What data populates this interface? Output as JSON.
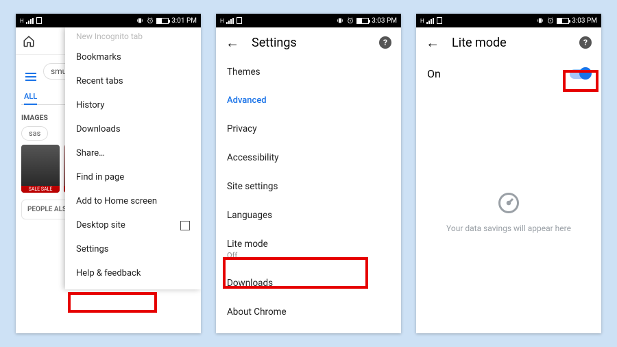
{
  "statusbar": {
    "network_label": "H",
    "time1": "3:01 PM",
    "time2": "3:03 PM",
    "time3": "3:03 PM"
  },
  "screen1": {
    "menu_faded_header": "New Incognito tab",
    "menu_items": [
      "Bookmarks",
      "Recent tabs",
      "History",
      "Downloads",
      "Share…",
      "Find in page",
      "Add to Home screen",
      "Desktop site",
      "Settings",
      "Help & feedback"
    ],
    "search_chip_text": "smu",
    "tab_all": "ALL",
    "section_images": "IMAGES",
    "chip_sas": "sas",
    "thumb_tag": "SALE SALE",
    "section_people": "PEOPLE ALSO ASK"
  },
  "screen2": {
    "title": "Settings",
    "items": {
      "themes": "Themes",
      "advanced": "Advanced",
      "privacy": "Privacy",
      "accessibility": "Accessibility",
      "site_settings": "Site settings",
      "languages": "Languages",
      "lite_mode": "Lite mode",
      "lite_mode_sub": "Off",
      "downloads": "Downloads",
      "about_chrome": "About Chrome"
    }
  },
  "screen3": {
    "title": "Lite mode",
    "on_label": "On",
    "message": "Your data savings will appear here"
  }
}
